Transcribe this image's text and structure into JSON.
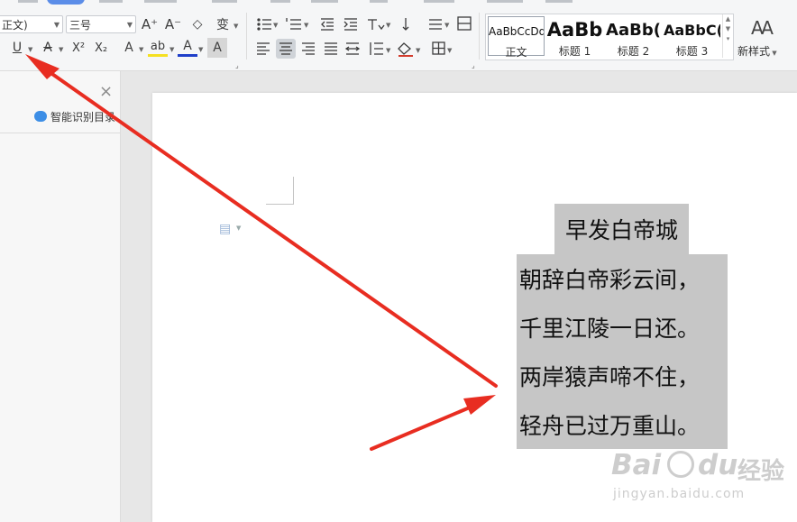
{
  "ribbon": {
    "font_name_value": "正文)",
    "font_size_value": "三号",
    "styles_gallery": [
      {
        "sample": "AaBbCcDd",
        "name": "正文",
        "selected": true
      },
      {
        "sample": "AaBb",
        "name": "标题 1",
        "selected": false
      },
      {
        "sample": "AaBb(",
        "name": "标题 2",
        "selected": false
      },
      {
        "sample": "AaBbC(",
        "name": "标题 3",
        "selected": false
      }
    ],
    "new_style_label": "新样式",
    "new_style_icon_glyph": "A"
  },
  "nav_pane": {
    "smart_toc_label": "智能识别目录",
    "close_glyph": "×"
  },
  "document": {
    "title": "早发白帝城",
    "lines": [
      "朝辞白帝彩云间，",
      "千里江陵一日还。",
      "两岸猿声啼不住，",
      "轻舟已过万重山。"
    ],
    "highlight_color": "#c6c6c6"
  },
  "watermark": {
    "brand": "Bai",
    "brand_suffix": "du",
    "tagline": "经验",
    "url": "jingyan.baidu.com"
  },
  "annotation": {
    "arrow_color": "#e82d21"
  },
  "icons": {
    "underline": "U",
    "strikethrough": "A",
    "superscript": "X²",
    "subscript": "X₂",
    "text_effect": "A",
    "highlight": "ab",
    "font_color": "A",
    "char_shading": "A",
    "grow_font": "A⁺",
    "shrink_font": "A⁻",
    "clear_format": "◇",
    "phonetic": "变"
  }
}
